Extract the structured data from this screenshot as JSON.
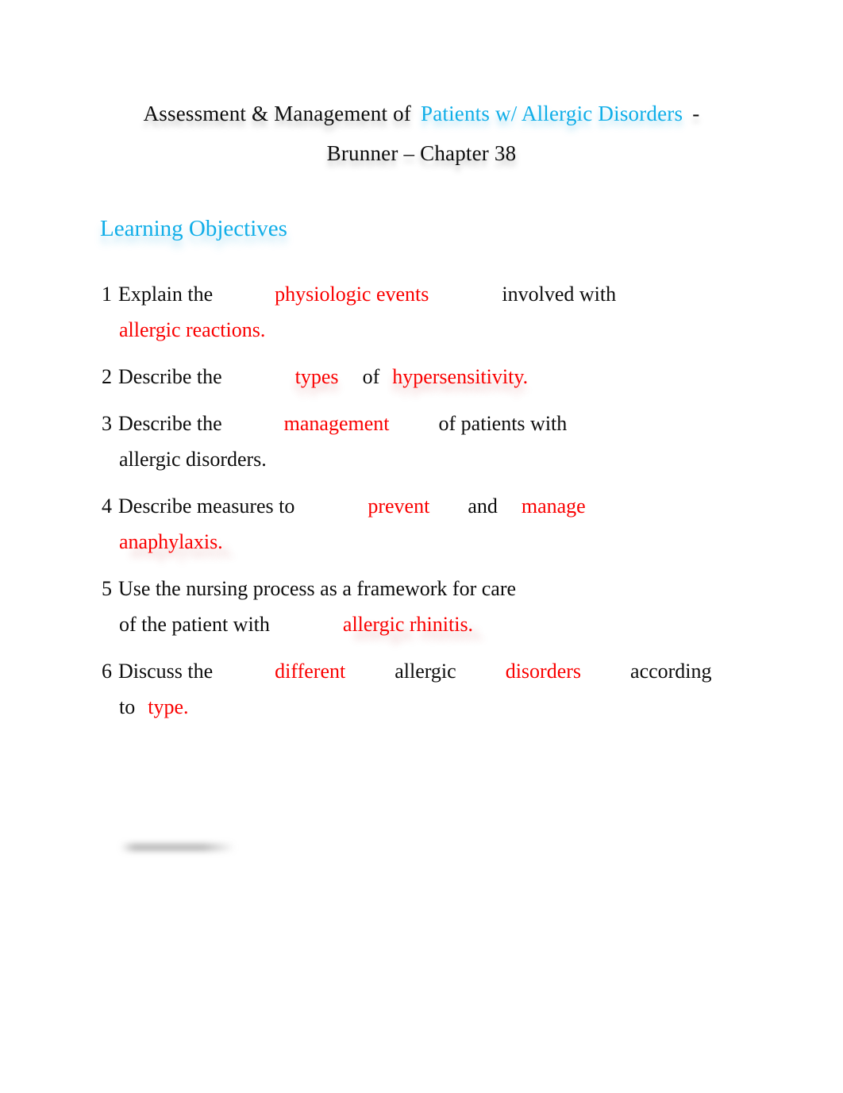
{
  "document": {
    "background_color": "#ffffff",
    "accent_cyan": "#10AEE8",
    "accent_red": "#FA0000",
    "text_color": "#0d0d0d"
  },
  "title": {
    "line1_part1": "Assessment & Management of",
    "line1_highlight": "Patients w/ Allergic Disorders",
    "line1_part2": "-",
    "line2": "Brunner – Chapter 38"
  },
  "heading": {
    "text": "Learning Objectives"
  },
  "objectives": [
    {
      "number": "1",
      "line1": [
        {
          "text": "Explain the",
          "color": "black"
        },
        {
          "text": "physiologic events",
          "color": "red"
        },
        {
          "text": "involved with",
          "color": "black"
        }
      ],
      "line2": [
        {
          "text": "allergic reactions.",
          "color": "red"
        }
      ]
    },
    {
      "number": "2",
      "line1": [
        {
          "text": "Describe the",
          "color": "black"
        },
        {
          "text": "types",
          "color": "red"
        },
        {
          "text": "of",
          "color": "black"
        },
        {
          "text": "hypersensitivity.",
          "color": "red"
        }
      ],
      "line2": []
    },
    {
      "number": "3",
      "line1": [
        {
          "text": "Describe the",
          "color": "black"
        },
        {
          "text": "management",
          "color": "red"
        },
        {
          "text": "of patients with",
          "color": "black"
        }
      ],
      "line2": [
        {
          "text": "allergic disorders.",
          "color": "black"
        }
      ]
    },
    {
      "number": "4",
      "line1": [
        {
          "text": "Describe measures to",
          "color": "black"
        },
        {
          "text": "prevent",
          "color": "red"
        },
        {
          "text": "and",
          "color": "black"
        },
        {
          "text": "manage",
          "color": "red"
        }
      ],
      "line2": [
        {
          "text": "anaphylaxis.",
          "color": "red"
        }
      ]
    },
    {
      "number": "5",
      "line1": [
        {
          "text": "Use the nursing process as a framework for care",
          "color": "black"
        }
      ],
      "line2": [
        {
          "text": "of the patient with",
          "color": "black"
        },
        {
          "text": "allergic rhinitis.",
          "color": "red"
        }
      ]
    },
    {
      "number": "6",
      "line1": [
        {
          "text": "Discuss the",
          "color": "black"
        },
        {
          "text": "different",
          "color": "red"
        },
        {
          "text": "allergic",
          "color": "black"
        },
        {
          "text": "disorders",
          "color": "red"
        },
        {
          "text": "according",
          "color": "black"
        }
      ],
      "line2": [
        {
          "text": "to",
          "color": "black"
        },
        {
          "text": "type.",
          "color": "red"
        }
      ]
    }
  ]
}
